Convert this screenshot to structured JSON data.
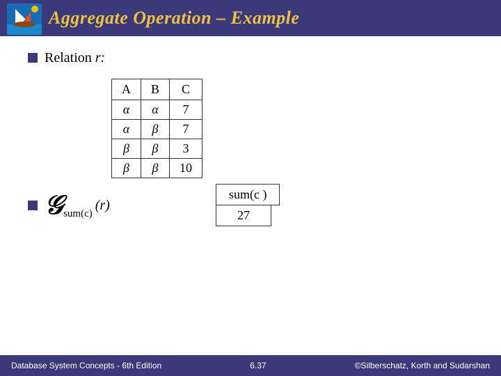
{
  "header": {
    "title": "Aggregate Operation – Example"
  },
  "section1": {
    "bullet": "■",
    "label": "Relation",
    "variable": "r:"
  },
  "table": {
    "headers": [
      "A",
      "B",
      "C"
    ],
    "rows": [
      [
        "α",
        "α",
        "7"
      ],
      [
        "α",
        "β",
        "7"
      ],
      [
        "β",
        "β",
        "3"
      ],
      [
        "β",
        "β",
        "10"
      ]
    ]
  },
  "section2": {
    "g_symbol": "𝐺",
    "subscript": "sum(c)",
    "r_label": "(r)"
  },
  "result": {
    "header": "sum(c )",
    "value": "27"
  },
  "footer": {
    "left": "Database System Concepts - 6th Edition",
    "center": "6.37",
    "right": "©Silberschatz, Korth and Sudarshan"
  }
}
